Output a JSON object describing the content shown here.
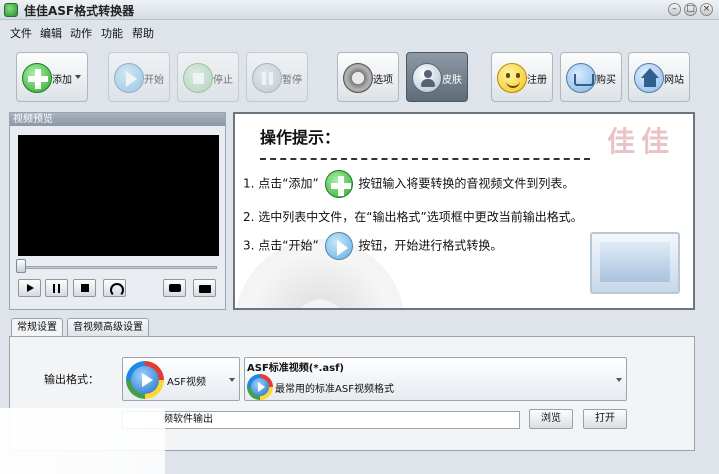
{
  "window": {
    "title": "佳佳ASF格式转换器"
  },
  "menu": [
    "文件",
    "编辑",
    "动作",
    "功能",
    "帮助"
  ],
  "toolbar": {
    "add": "添加",
    "start": "开始",
    "stop": "停止",
    "pause": "暂停",
    "options": "选项",
    "skin": "皮肤",
    "register": "注册",
    "buy": "购买",
    "website": "网站"
  },
  "preview": {
    "header": "视频预览"
  },
  "tips": {
    "title": "操作提示：",
    "brand": "佳佳",
    "step1_pre": "1. 点击“添加”",
    "step1_post": "按钮输入将要转换的音视频文件到列表。",
    "step2": "2. 选中列表中文件，在“输出格式”选项框中更改当前输出格式。",
    "step3_pre": "3. 点击“开始”",
    "step3_post": "按钮，开始进行格式转换。"
  },
  "tabs": [
    "常规设置",
    "音视频高级设置"
  ],
  "settings": {
    "output_format_label": "输出格式：",
    "format_value": "ASF视频",
    "quality_title": "ASF标准视频(*.asf)",
    "quality_desc": "最常用的标准ASF视频格式",
    "output_dir_value": "频软件输出",
    "browse": "浏览",
    "open": "打开"
  }
}
